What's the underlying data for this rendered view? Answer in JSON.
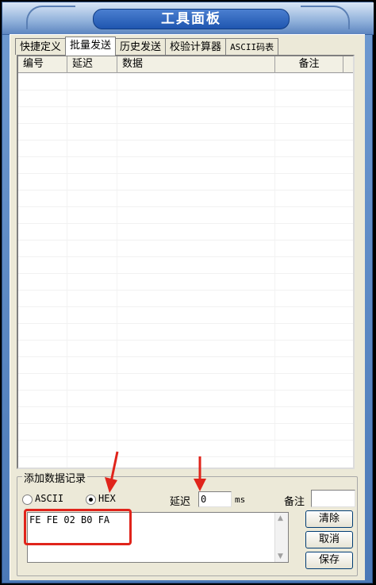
{
  "window": {
    "title": "工具面板"
  },
  "tabs": [
    {
      "label": "快捷定义"
    },
    {
      "label": "批量发送"
    },
    {
      "label": "历史发送"
    },
    {
      "label": "校验计算器"
    },
    {
      "label": "ASCII码表"
    }
  ],
  "list": {
    "columns": [
      "编号",
      "延迟",
      "数据",
      "备注"
    ]
  },
  "add_record": {
    "group_label": "添加数据记录",
    "mode_ascii": "ASCII",
    "mode_hex": "HEX",
    "selected_mode": "HEX",
    "delay_label": "延迟",
    "delay_value": "0",
    "delay_unit": "ms",
    "note_label": "备注",
    "note_value": "",
    "data_value": "FE FE 02 B0 FA"
  },
  "buttons": {
    "clear": "清除",
    "cancel": "取消",
    "save": "保存"
  },
  "colors": {
    "annotation_red": "#e0241b",
    "title_blue": "#1f56b0",
    "panel_bg": "#ece9d8"
  }
}
